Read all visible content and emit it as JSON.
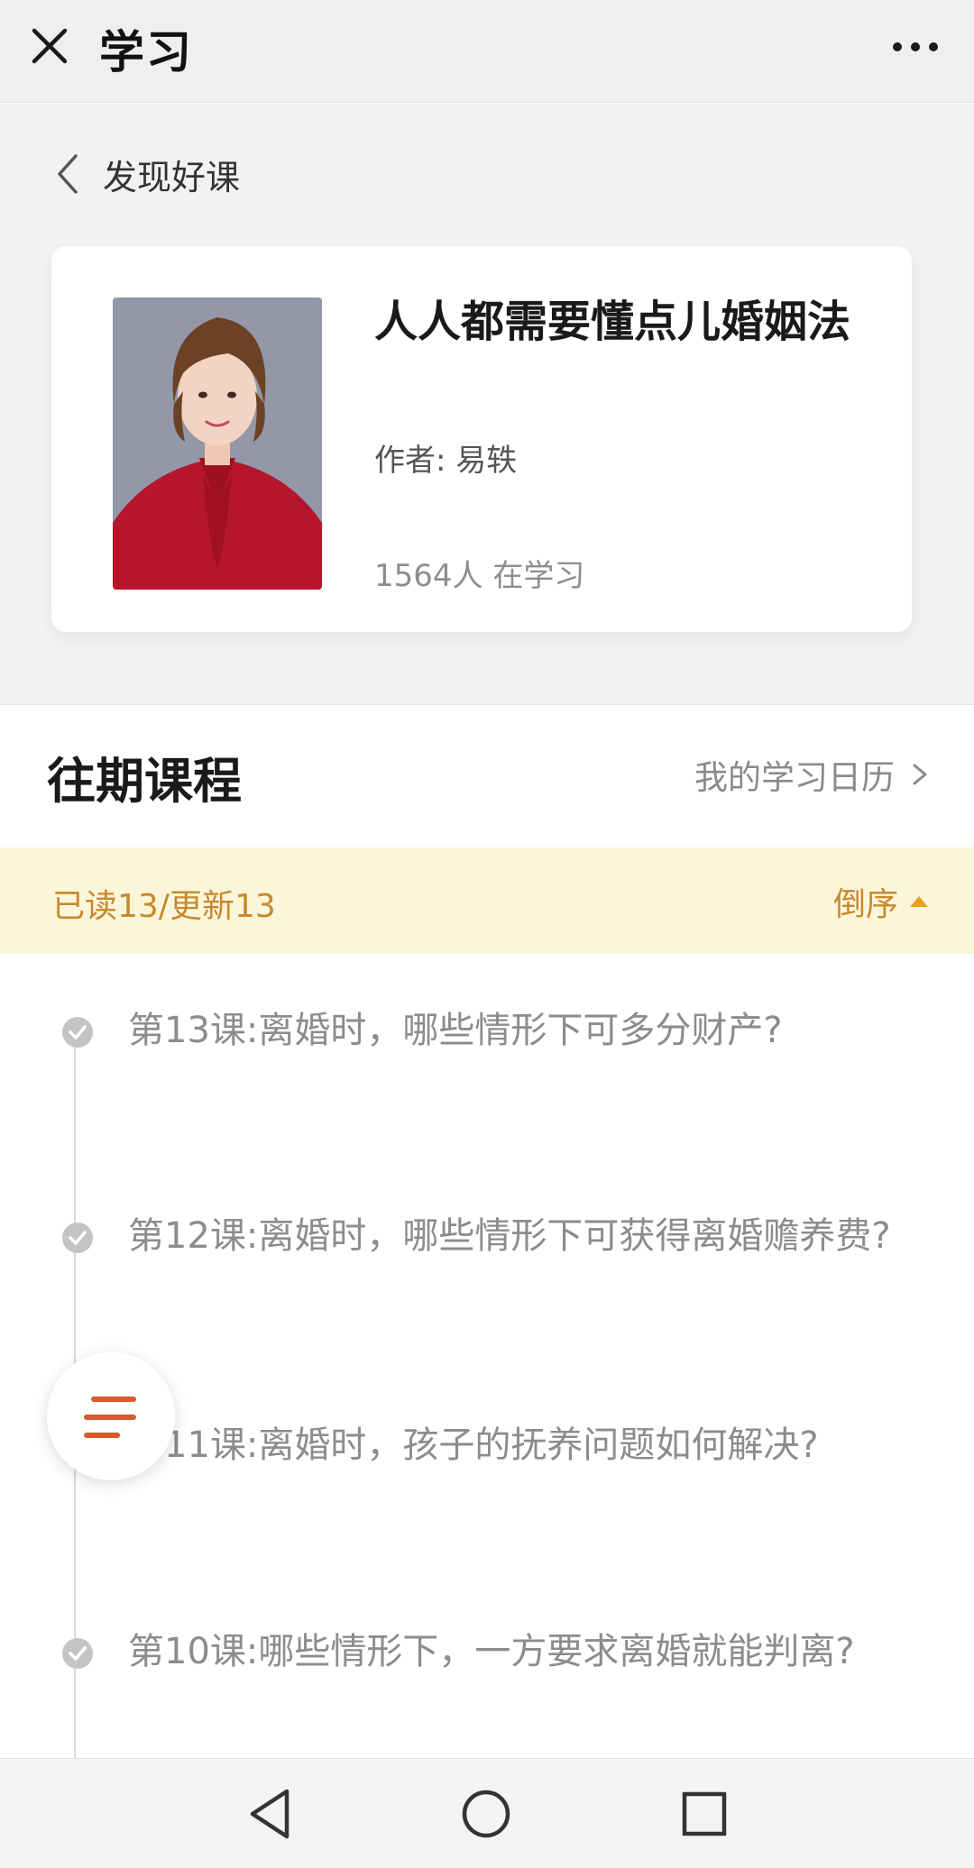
{
  "topbar": {
    "title": "学习",
    "close_icon": "close-icon",
    "more_icon": "more-horizontal-icon"
  },
  "header": {
    "back_label": "发现好课",
    "back_icon": "chevron-left-icon"
  },
  "course": {
    "title": "人人都需要懂点儿婚姻法",
    "author": "作者: 易轶",
    "learners": "1564人 在学习",
    "image": "author-portrait"
  },
  "section": {
    "title": "往期课程",
    "calendar_label": "我的学习日历",
    "calendar_icon": "chevron-right-icon"
  },
  "progress": {
    "text": "已读13/更新13",
    "sort_label": "倒序",
    "sort_icon": "triangle-up-icon",
    "accent_color": "#c8892e",
    "background_color": "#fbf6da"
  },
  "lessons": [
    {
      "title": "第13课:离婚时，哪些情形下可多分财产?",
      "status": "read"
    },
    {
      "title": "第12课:离婚时，哪些情形下可获得离婚赡养费?",
      "status": "read"
    },
    {
      "title": "第11课:离婚时，孩子的抚养问题如何解决?",
      "status": "read"
    },
    {
      "title": "第10课:哪些情形下，一方要求离婚就能判离?",
      "status": "read"
    }
  ],
  "fab": {
    "icon": "menu-lines-icon",
    "color": "#d65a2c"
  },
  "bottom_nav": {
    "back_icon": "triangle-back-icon",
    "home_icon": "circle-home-icon",
    "recents_icon": "square-recents-icon"
  }
}
